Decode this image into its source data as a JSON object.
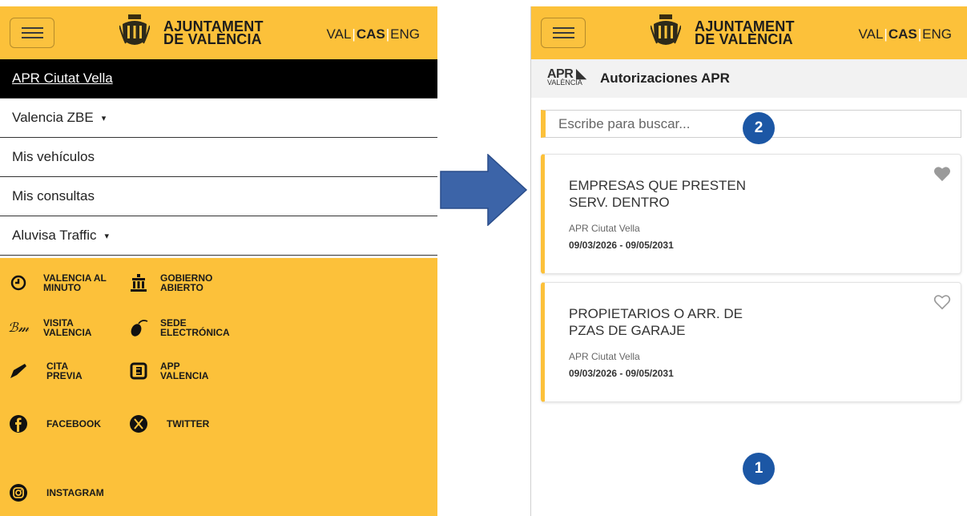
{
  "header": {
    "brand_line1": "AJUNTAMENT",
    "brand_line2": "DE VALÈNCIA",
    "lang_val": "VAL",
    "lang_cas": "CAS",
    "lang_eng": "ENG",
    "lang_sep": "|"
  },
  "left_menu": {
    "items": [
      {
        "label": "APR Ciutat Vella"
      },
      {
        "label": "Valencia ZBE",
        "caret": "▾"
      },
      {
        "label": "Mis vehículos"
      },
      {
        "label": "Mis consultas"
      },
      {
        "label": "Aluvisa Traffic",
        "caret": "▾"
      }
    ]
  },
  "footer_links": [
    {
      "label": "VALENCIA AL\nMINUTO",
      "icon": "clock-icon"
    },
    {
      "label": "GOBIERNO\nABIERTO",
      "icon": "building-icon"
    },
    {
      "label": "VISITA\nVALENCIA",
      "icon": "visit-logo-icon"
    },
    {
      "label": "SEDE\nELECTRÓNICA",
      "icon": "mouse-icon"
    },
    {
      "label": "CITA\nPREVIA",
      "icon": "pen-icon"
    },
    {
      "label": "APP\nVALENCIA",
      "icon": "app-icon"
    },
    {
      "label": "FACEBOOK",
      "icon": "facebook-icon"
    },
    {
      "label": "TWITTER",
      "icon": "twitter-x-icon"
    },
    {
      "label": "INSTAGRAM",
      "icon": "instagram-icon"
    }
  ],
  "apr": {
    "logo_big": "APR",
    "logo_small": "VALÈNCIA",
    "title": "Autorizaciones APR",
    "search_placeholder": "Escribe para buscar..."
  },
  "cards": [
    {
      "title": "EMPRESAS QUE PRESTEN\nSERV. DENTRO",
      "zone": "APR Ciutat Vella",
      "dates": "09/03/2026 - 09/05/2031",
      "favorite": true
    },
    {
      "title": "PROPIETARIOS O ARR. DE\nPZAS DE GARAJE",
      "zone": "APR Ciutat Vella",
      "dates": "09/03/2026 - 09/05/2031",
      "favorite": false
    }
  ],
  "badges": {
    "one": "1",
    "two": "2"
  },
  "colors": {
    "brand_yellow": "#fcc13a",
    "badge_blue": "#1c57a5",
    "arrow_blue": "#3c64a8"
  }
}
